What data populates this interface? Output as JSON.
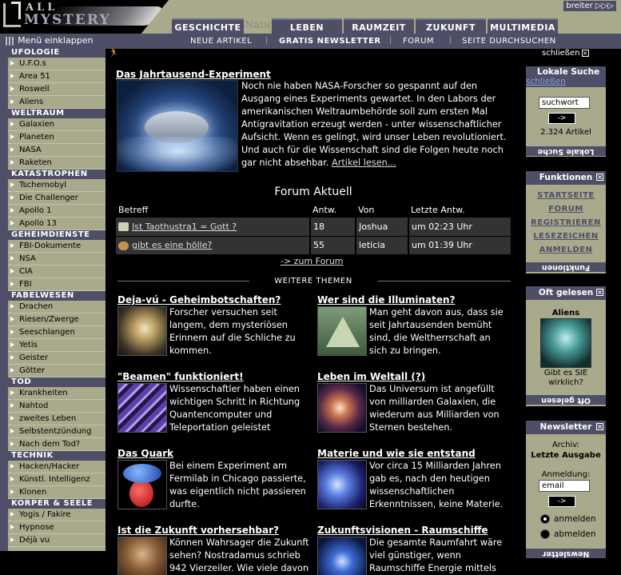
{
  "logo": {
    "line1": "ALL",
    "line2": "MYSTERY"
  },
  "header": {
    "breiter": "breiter ▷▷▷",
    "ghost": "Natu",
    "tabs": [
      "GESCHICHTE",
      "LEBEN",
      "RAUMZEIT",
      "ZUKUNFT",
      "MULTIMEDIA"
    ],
    "menu_toggle": "Menü einklappen",
    "subnav": [
      "NEUE ARTIKEL",
      "GRATIS NEWSLETTER",
      "FORUM",
      "SEITE DURCHSUCHEN"
    ],
    "schliessen": "schließen"
  },
  "sidebar": {
    "groups": [
      {
        "title": "UFOLOGIE",
        "items": [
          "U.F.O.s",
          "Area 51",
          "Roswell",
          "Aliens"
        ]
      },
      {
        "title": "WELTRAUM",
        "items": [
          "Galaxien",
          "Planeten",
          "NASA",
          "Raketen"
        ]
      },
      {
        "title": "KATASTROPHEN",
        "items": [
          "Tschernobyl",
          "Die Challenger",
          "Apollo 1",
          "Apollo 13"
        ]
      },
      {
        "title": "GEHEIMDIENSTE",
        "items": [
          "FBI-Dokumente",
          "NSA",
          "CIA",
          "FBI"
        ]
      },
      {
        "title": "FABELWESEN",
        "items": [
          "Drachen",
          "Riesen/Zwerge",
          "Seeschlangen",
          "Yetis",
          "Geister",
          "Götter"
        ]
      },
      {
        "title": "TOD",
        "items": [
          "Krankheiten",
          "Nahtod",
          "zweites Leben",
          "Selbstentzündung",
          "Nach dem Tod?"
        ]
      },
      {
        "title": "TECHNIK",
        "items": [
          "Hacken/Hacker",
          "Künstl. Intelligenz",
          "Klonen"
        ]
      },
      {
        "title": "KÖRPER & SEELE",
        "items": [
          "Yogis / Fakire",
          "Hypnose",
          "Déjà vu"
        ]
      }
    ]
  },
  "hero": {
    "title": "Das Jahrtausend-Experiment",
    "text": "Noch nie haben NASA-Forscher so gespannt auf den Ausgang eines Experiments gewartet. In den Labors der amerikanischen Weltraumbehörde soll zum ersten Mal Antigravitation erzeugt werden - unter wissenschaftlicher Aufsicht. Wenn es gelingt, wird unser Leben revolutioniert. Und auch für die Wissenschaft sind die Folgen heute noch gar nicht absehbar.",
    "more": "Artikel lesen..."
  },
  "forum": {
    "title": "Forum Aktuell",
    "columns": [
      "Betreff",
      "Antw.",
      "Von",
      "Letzte Antw."
    ],
    "rows": [
      {
        "subject": "Ist Taothustra1 = Gott ?",
        "replies": "18",
        "from": "Joshua",
        "last": "um 02:23 Uhr"
      },
      {
        "subject": "gibt es eine hölle?",
        "replies": "55",
        "from": "leticia",
        "last": "um 01:39 Uhr"
      }
    ],
    "more": "-> zum Forum"
  },
  "weitere": "WEITERE THEMEN",
  "teasers": [
    {
      "title": "Deja-vú - Geheimbotschaften?",
      "text": "Forscher versuchen seit langem, dem mysteriösen Erinnern auf die Schliche zu kommen."
    },
    {
      "title": "Wer sind die Illuminaten?",
      "text": "Man geht davon aus, dass sie seit Jahrtausenden bemüht sind, die Weltherrschaft an sich zu bringen."
    },
    {
      "title": "\"Beamen\" funktioniert!",
      "text": "Wissenschaftler haben einen wichtigen Schritt in Richtung Quantencomputer und Teleportation geleistet"
    },
    {
      "title": "Leben im Weltall (?)",
      "text": "Das Universum ist angefüllt von milliarden Galaxien, die wiederum aus Milliarden von Sternen bestehen."
    },
    {
      "title": "Das Quark",
      "text": "Bei einem Experiment am Fermilab in Chicago passierte, was eigentlich nicht passieren durfte."
    },
    {
      "title": "Materie und wie sie entstand",
      "text": "Vor circa 15 Milliarden Jahren gab es, nach den heutigen wissenschaftlichen Erkenntnissen, keine Materie."
    },
    {
      "title": "Ist die Zukunft vorhersehbar?",
      "text": "Können Wahrsager die Zukunft sehen? Nostradamus schrieb 942 Vierzeiler. Wie viele davon"
    },
    {
      "title": "Zukunftsvisionen - Raumschiffe",
      "text": "Die gesamte Raumfahrt wäre viel günstiger, wenn Raumschiffe Energie mittels"
    }
  ],
  "right": {
    "search": {
      "title": "Lokale Suche",
      "close": "schließen",
      "value": "suchwort",
      "go": "->",
      "count": "2.324 Artikel",
      "foot": "Lokale Suche"
    },
    "funktionen": {
      "title": "Funktionen",
      "links": [
        "STARTSEITE",
        "FORUM",
        "REGISTRIEREN",
        "LESEZEICHEN",
        "ANMELDEN"
      ],
      "foot": "Funktionen"
    },
    "oft": {
      "title": "Oft gelesen",
      "item": "Aliens",
      "caption1": "Gibt es SIE",
      "caption2": "wirklich?",
      "foot": "Oft gelesen"
    },
    "news": {
      "title": "Newsletter",
      "archiv": "Archiv:",
      "latest": "Letzte Ausgabe",
      "anm": "Anmeldung:",
      "value": "email",
      "go": "->",
      "opt1": "anmelden",
      "opt2": "abmelden",
      "foot": "Newsletter"
    }
  },
  "colors": {
    "olive": "#a9a98c",
    "slate": "#4e4e66",
    "background": "#000000"
  }
}
